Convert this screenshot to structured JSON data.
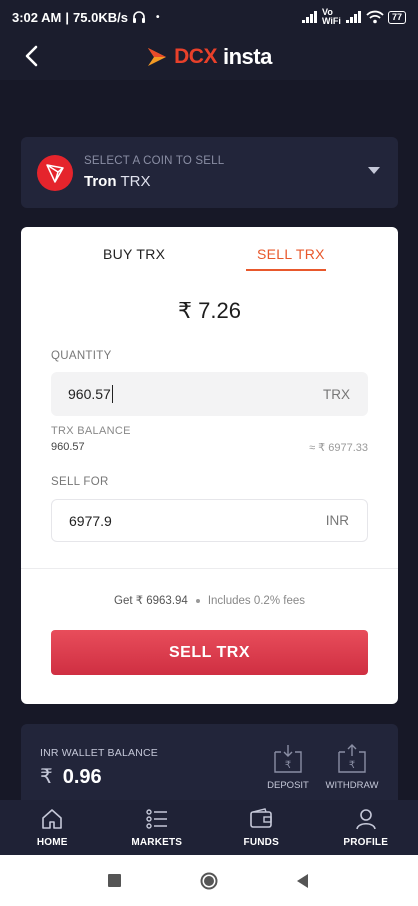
{
  "status_bar": {
    "time": "3:02 AM",
    "separator": "|",
    "speed": "75.0KB/s",
    "dot": "•",
    "network_label": "Vo WiFi",
    "battery": "77"
  },
  "app": {
    "logo_brand": "DCX",
    "logo_suffix": "insta"
  },
  "coin_selector": {
    "hint": "SELECT A COIN TO SELL",
    "coin_name": "Tron",
    "coin_symbol": "TRX"
  },
  "trade": {
    "tabs": [
      {
        "label": "BUY TRX",
        "active": false
      },
      {
        "label": "SELL TRX",
        "active": true
      }
    ],
    "price": "₹ 7.26",
    "quantity_label": "QUANTITY",
    "quantity_value": "960.57",
    "quantity_unit": "TRX",
    "balance_label": "TRX BALANCE",
    "balance_value": "960.57",
    "balance_inr": "≈ ₹ 6977.33",
    "sell_for_label": "SELL FOR",
    "sell_for_value": "6977.9",
    "sell_for_unit": "INR",
    "get_text": "Get ₹ 6963.94",
    "fees_text": "Includes 0.2% fees",
    "sell_button": "SELL TRX"
  },
  "wallet": {
    "label": "INR WALLET BALANCE",
    "currency": "₹",
    "value": "0.96",
    "deposit_label": "DEPOSIT",
    "withdraw_label": "WITHDRAW"
  },
  "bottom_nav": {
    "items": [
      {
        "label": "HOME",
        "icon": "home-icon"
      },
      {
        "label": "MARKETS",
        "icon": "list-icon"
      },
      {
        "label": "FUNDS",
        "icon": "wallet-icon"
      },
      {
        "label": "PROFILE",
        "icon": "user-icon"
      }
    ]
  },
  "colors": {
    "background": "#1a1c2c",
    "card_dark": "#22253a",
    "accent_orange": "#e8582c",
    "sell_red": "#d63a4c",
    "tron_red": "#e5242c"
  }
}
